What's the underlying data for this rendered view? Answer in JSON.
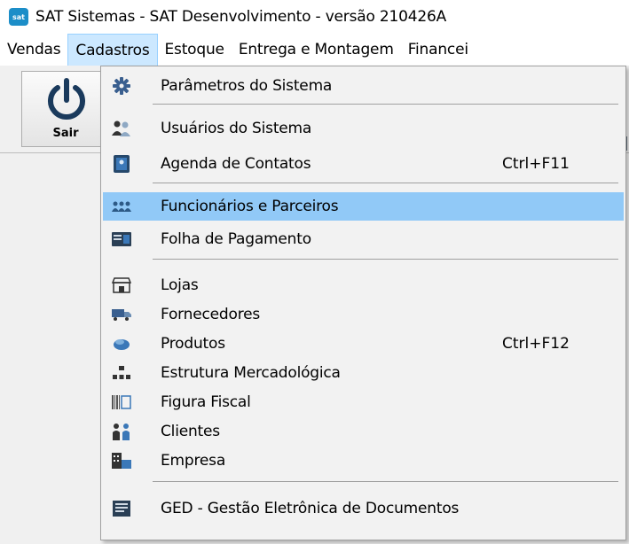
{
  "window": {
    "title": "SAT Sistemas - SAT Desenvolvimento - versão 210426A",
    "app_icon_text": "sat"
  },
  "menubar": [
    {
      "label": "Vendas"
    },
    {
      "label": "Cadastros"
    },
    {
      "label": "Estoque"
    },
    {
      "label": "Entrega e Montagem"
    },
    {
      "label": "Financei"
    }
  ],
  "toolbar": {
    "sair_label": "Sair"
  },
  "cadastros_menu": {
    "highlighted": "Funcionários e Parceiros",
    "items": [
      {
        "label": "Parâmetros do Sistema",
        "shortcut": "",
        "icon": "gear-icon"
      },
      {
        "label": "Usuários do Sistema",
        "shortcut": "",
        "icon": "users-icon"
      },
      {
        "label": "Agenda de Contatos",
        "shortcut": "Ctrl+F11",
        "icon": "contact-book-icon"
      },
      {
        "label": "Funcionários e Parceiros",
        "shortcut": "",
        "icon": "employees-icon"
      },
      {
        "label": "Folha de Pagamento",
        "shortcut": "",
        "icon": "payroll-icon"
      },
      {
        "label": "Lojas",
        "shortcut": "",
        "icon": "store-icon"
      },
      {
        "label": "Fornecedores",
        "shortcut": "",
        "icon": "truck-icon"
      },
      {
        "label": "Produtos",
        "shortcut": "Ctrl+F12",
        "icon": "products-icon"
      },
      {
        "label": "Estrutura Mercadológica",
        "shortcut": "",
        "icon": "hierarchy-icon"
      },
      {
        "label": "Figura Fiscal",
        "shortcut": "",
        "icon": "barcode-icon"
      },
      {
        "label": "Clientes",
        "shortcut": "",
        "icon": "clients-icon"
      },
      {
        "label": "Empresa",
        "shortcut": "",
        "icon": "building-icon"
      },
      {
        "label": "GED - Gestão Eletrônica de Documentos",
        "shortcut": "",
        "icon": "document-icon"
      }
    ]
  }
}
